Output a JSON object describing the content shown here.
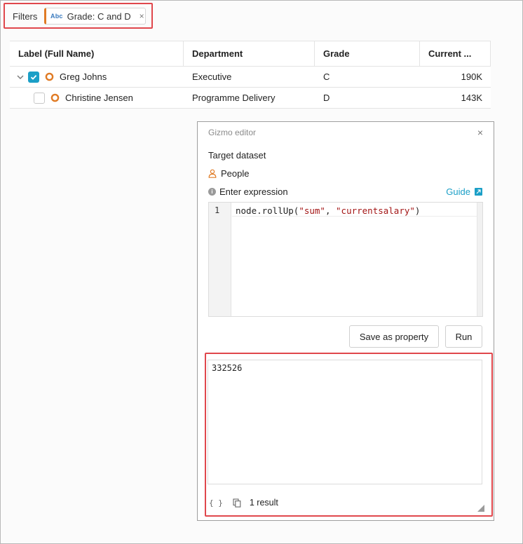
{
  "filters": {
    "label": "Filters",
    "chip": {
      "type_badge": "Abc",
      "text": "Grade: C and D",
      "close": "×"
    }
  },
  "table": {
    "columns": [
      "Label (Full Name)",
      "Department",
      "Grade",
      "Current ..."
    ],
    "rows": [
      {
        "name": "Greg Johns",
        "department": "Executive",
        "grade": "C",
        "salary": "190K",
        "checked": true,
        "expanded": true
      },
      {
        "name": "Christine Jensen",
        "department": "Programme Delivery",
        "grade": "D",
        "salary": "143K",
        "checked": false
      }
    ]
  },
  "gizmo": {
    "title": "Gizmo editor",
    "close": "×",
    "target_label": "Target dataset",
    "dataset": "People",
    "expression_label": "Enter expression",
    "guide_label": "Guide",
    "line_number": "1",
    "code_prefix": "node.rollUp(",
    "code_arg1": "\"sum\"",
    "code_sep": ", ",
    "code_arg2": "\"currentsalary\"",
    "code_suffix": ")",
    "save_button": "Save as property",
    "run_button": "Run",
    "result_value": "332526",
    "result_count": "1 result",
    "braces_glyph": "{ }"
  },
  "colors": {
    "accent": "#1b9fc7",
    "highlight": "#e0474c",
    "node_orange": "#e07b25"
  }
}
